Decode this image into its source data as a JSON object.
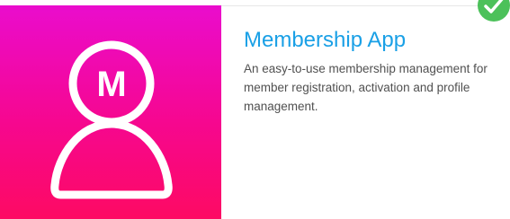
{
  "app_card": {
    "title": "Membership App",
    "description": "An easy-to-use membership management for member registration, activation and profile management.",
    "logo_letter": "M",
    "icon": "member-avatar-icon",
    "badge_icon": "check-icon",
    "colors": {
      "gradient_top": "#ea0ccd",
      "gradient_bottom": "#fd0a63",
      "title": "#1aa0e6",
      "badge": "#4cc15a"
    }
  }
}
